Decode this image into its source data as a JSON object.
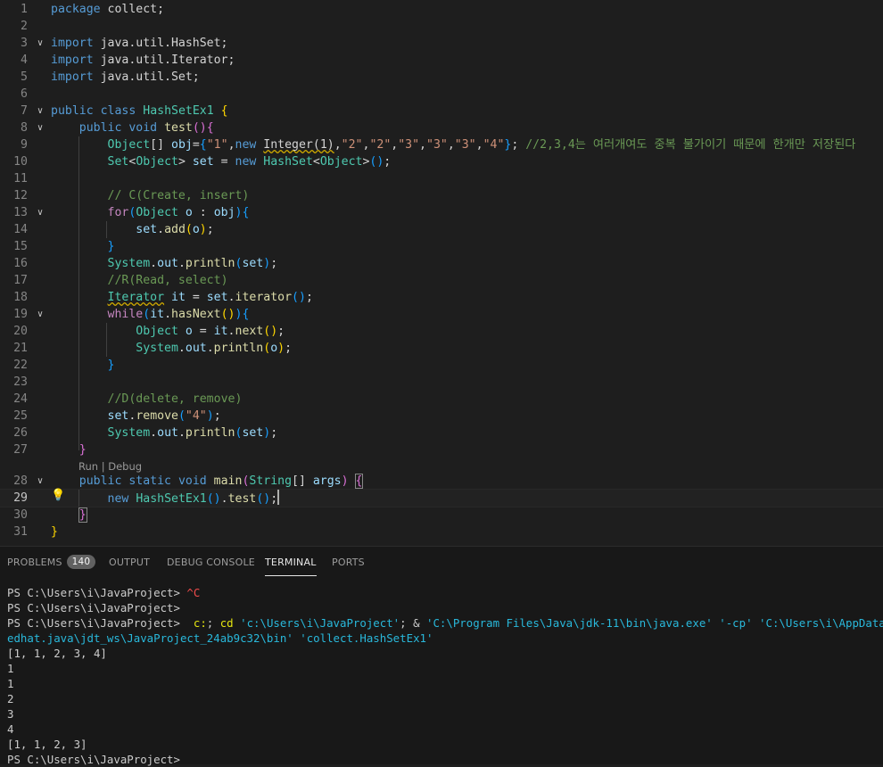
{
  "editor": {
    "lines": [
      {
        "n": "1",
        "tokens": [
          [
            "kw",
            "package"
          ],
          [
            "pl",
            " collect;"
          ]
        ]
      },
      {
        "n": "2",
        "tokens": []
      },
      {
        "n": "3",
        "fold": true,
        "tokens": [
          [
            "kw",
            "import"
          ],
          [
            "pl",
            " java.util.HashSet;"
          ]
        ]
      },
      {
        "n": "4",
        "tokens": [
          [
            "kw",
            "import"
          ],
          [
            "pl",
            " java.util.Iterator;"
          ]
        ]
      },
      {
        "n": "5",
        "tokens": [
          [
            "kw",
            "import"
          ],
          [
            "pl",
            " java.util.Set;"
          ]
        ]
      },
      {
        "n": "6",
        "tokens": []
      },
      {
        "n": "7",
        "fold": true,
        "tokens": [
          [
            "kw",
            "public"
          ],
          [
            "pl",
            " "
          ],
          [
            "kw",
            "class"
          ],
          [
            "pl",
            " "
          ],
          [
            "typ",
            "HashSetEx1"
          ],
          [
            "pl",
            " "
          ],
          [
            "br1",
            "{"
          ]
        ]
      },
      {
        "n": "8",
        "fold": true,
        "tokens": [
          [
            "pl",
            "    "
          ],
          [
            "kw",
            "public"
          ],
          [
            "pl",
            " "
          ],
          [
            "kw",
            "void"
          ],
          [
            "pl",
            " "
          ],
          [
            "fn",
            "test"
          ],
          [
            "br2",
            "()"
          ],
          [
            "br2",
            "{"
          ]
        ]
      },
      {
        "n": "9",
        "tokens": [
          [
            "pl",
            "        "
          ],
          [
            "typ",
            "Object"
          ],
          [
            "pl",
            "[] "
          ],
          [
            "var",
            "obj"
          ],
          [
            "pl",
            "="
          ],
          [
            "br3",
            "{"
          ],
          [
            "str",
            "\"1\""
          ],
          [
            "pl",
            ","
          ],
          [
            "kw",
            "new"
          ],
          [
            "pl",
            " "
          ],
          [
            "depwarn",
            "Integer(1)"
          ],
          [
            "pl",
            ","
          ],
          [
            "str",
            "\"2\""
          ],
          [
            "pl",
            ","
          ],
          [
            "str",
            "\"2\""
          ],
          [
            "pl",
            ","
          ],
          [
            "str",
            "\"3\""
          ],
          [
            "pl",
            ","
          ],
          [
            "str",
            "\"3\""
          ],
          [
            "pl",
            ","
          ],
          [
            "str",
            "\"3\""
          ],
          [
            "pl",
            ","
          ],
          [
            "str",
            "\"4\""
          ],
          [
            "br3",
            "}"
          ],
          [
            "pl",
            "; "
          ],
          [
            "com",
            "//2,3,4는 여러개여도 중복 불가이기 때문에 한개만 저장된다"
          ]
        ]
      },
      {
        "n": "10",
        "tokens": [
          [
            "pl",
            "        "
          ],
          [
            "typ",
            "Set"
          ],
          [
            "pl",
            "<"
          ],
          [
            "typ",
            "Object"
          ],
          [
            "pl",
            "> "
          ],
          [
            "var",
            "set"
          ],
          [
            "pl",
            " = "
          ],
          [
            "kw",
            "new"
          ],
          [
            "pl",
            " "
          ],
          [
            "typ",
            "HashSet"
          ],
          [
            "pl",
            "<"
          ],
          [
            "typ",
            "Object"
          ],
          [
            "pl",
            ">"
          ],
          [
            "br3",
            "()"
          ],
          [
            "pl",
            ";"
          ]
        ]
      },
      {
        "n": "11",
        "tokens": []
      },
      {
        "n": "12",
        "tokens": [
          [
            "pl",
            "        "
          ],
          [
            "com",
            "// C(Create, insert)"
          ]
        ]
      },
      {
        "n": "13",
        "fold": true,
        "tokens": [
          [
            "pl",
            "        "
          ],
          [
            "ctl",
            "for"
          ],
          [
            "br3",
            "("
          ],
          [
            "typ",
            "Object"
          ],
          [
            "pl",
            " "
          ],
          [
            "var",
            "o"
          ],
          [
            "pl",
            " : "
          ],
          [
            "var",
            "obj"
          ],
          [
            "br3",
            ")"
          ],
          [
            "br3",
            "{"
          ]
        ]
      },
      {
        "n": "14",
        "tokens": [
          [
            "pl",
            "            "
          ],
          [
            "var",
            "set"
          ],
          [
            "pl",
            "."
          ],
          [
            "fn",
            "add"
          ],
          [
            "br1",
            "("
          ],
          [
            "var",
            "o"
          ],
          [
            "br1",
            ")"
          ],
          [
            "pl",
            ";"
          ]
        ]
      },
      {
        "n": "15",
        "tokens": [
          [
            "pl",
            "        "
          ],
          [
            "br3",
            "}"
          ]
        ]
      },
      {
        "n": "16",
        "tokens": [
          [
            "pl",
            "        "
          ],
          [
            "typ",
            "System"
          ],
          [
            "pl",
            "."
          ],
          [
            "var",
            "out"
          ],
          [
            "pl",
            "."
          ],
          [
            "fn",
            "println"
          ],
          [
            "br3",
            "("
          ],
          [
            "var",
            "set"
          ],
          [
            "br3",
            ")"
          ],
          [
            "pl",
            ";"
          ]
        ]
      },
      {
        "n": "17",
        "tokens": [
          [
            "pl",
            "        "
          ],
          [
            "com",
            "//R(Read, select)"
          ]
        ]
      },
      {
        "n": "18",
        "tokens": [
          [
            "pl",
            "        "
          ],
          [
            "typwarn",
            "Iterator"
          ],
          [
            "pl",
            " "
          ],
          [
            "var",
            "it"
          ],
          [
            "pl",
            " = "
          ],
          [
            "var",
            "set"
          ],
          [
            "pl",
            "."
          ],
          [
            "fn",
            "iterator"
          ],
          [
            "br3",
            "()"
          ],
          [
            "pl",
            ";"
          ]
        ]
      },
      {
        "n": "19",
        "fold": true,
        "tokens": [
          [
            "pl",
            "        "
          ],
          [
            "ctl",
            "while"
          ],
          [
            "br3",
            "("
          ],
          [
            "var",
            "it"
          ],
          [
            "pl",
            "."
          ],
          [
            "fn",
            "hasNext"
          ],
          [
            "br1",
            "()"
          ],
          [
            "br3",
            ")"
          ],
          [
            "br3",
            "{"
          ]
        ]
      },
      {
        "n": "20",
        "tokens": [
          [
            "pl",
            "            "
          ],
          [
            "typ",
            "Object"
          ],
          [
            "pl",
            " "
          ],
          [
            "var",
            "o"
          ],
          [
            "pl",
            " = "
          ],
          [
            "var",
            "it"
          ],
          [
            "pl",
            "."
          ],
          [
            "fn",
            "next"
          ],
          [
            "br1",
            "()"
          ],
          [
            "pl",
            ";"
          ]
        ]
      },
      {
        "n": "21",
        "tokens": [
          [
            "pl",
            "            "
          ],
          [
            "typ",
            "System"
          ],
          [
            "pl",
            "."
          ],
          [
            "var",
            "out"
          ],
          [
            "pl",
            "."
          ],
          [
            "fn",
            "println"
          ],
          [
            "br1",
            "("
          ],
          [
            "var",
            "o"
          ],
          [
            "br1",
            ")"
          ],
          [
            "pl",
            ";"
          ]
        ]
      },
      {
        "n": "22",
        "tokens": [
          [
            "pl",
            "        "
          ],
          [
            "br3",
            "}"
          ]
        ]
      },
      {
        "n": "23",
        "tokens": []
      },
      {
        "n": "24",
        "tokens": [
          [
            "pl",
            "        "
          ],
          [
            "com",
            "//D(delete, remove)"
          ]
        ]
      },
      {
        "n": "25",
        "tokens": [
          [
            "pl",
            "        "
          ],
          [
            "var",
            "set"
          ],
          [
            "pl",
            "."
          ],
          [
            "fn",
            "remove"
          ],
          [
            "br3",
            "("
          ],
          [
            "str",
            "\"4\""
          ],
          [
            "br3",
            ")"
          ],
          [
            "pl",
            ";"
          ]
        ]
      },
      {
        "n": "26",
        "tokens": [
          [
            "pl",
            "        "
          ],
          [
            "typ",
            "System"
          ],
          [
            "pl",
            "."
          ],
          [
            "var",
            "out"
          ],
          [
            "pl",
            "."
          ],
          [
            "fn",
            "println"
          ],
          [
            "br3",
            "("
          ],
          [
            "var",
            "set"
          ],
          [
            "br3",
            ")"
          ],
          [
            "pl",
            ";"
          ]
        ]
      },
      {
        "n": "27",
        "tokens": [
          [
            "pl",
            "    "
          ],
          [
            "br2",
            "}"
          ]
        ]
      },
      {
        "n": "28",
        "fold": true,
        "tokens": [
          [
            "pl",
            "    "
          ],
          [
            "kw",
            "public"
          ],
          [
            "pl",
            " "
          ],
          [
            "kw",
            "static"
          ],
          [
            "pl",
            " "
          ],
          [
            "kw",
            "void"
          ],
          [
            "pl",
            " "
          ],
          [
            "fn",
            "main"
          ],
          [
            "br2",
            "("
          ],
          [
            "typ",
            "String"
          ],
          [
            "pl",
            "[] "
          ],
          [
            "var",
            "args"
          ],
          [
            "br2",
            ")"
          ],
          [
            "pl",
            " "
          ],
          [
            "brk2",
            "{"
          ]
        ]
      },
      {
        "n": "29",
        "current": true,
        "tokens": [
          [
            "pl",
            "        "
          ],
          [
            "kw",
            "new"
          ],
          [
            "pl",
            " "
          ],
          [
            "typ",
            "HashSetEx1"
          ],
          [
            "br3",
            "()"
          ],
          [
            "pl",
            "."
          ],
          [
            "fn",
            "test"
          ],
          [
            "br3",
            "()"
          ],
          [
            "pl",
            ";"
          ],
          [
            "cursor",
            ""
          ]
        ]
      },
      {
        "n": "30",
        "tokens": [
          [
            "pl",
            "    "
          ],
          [
            "brk2",
            "}"
          ]
        ]
      },
      {
        "n": "31",
        "tokens": [
          [
            "br1",
            "}"
          ]
        ]
      }
    ],
    "codelens": "Run | Debug",
    "lightbulb": "💡"
  },
  "panel": {
    "tabs": [
      {
        "id": "problems",
        "label": "PROBLEMS",
        "badge": "140",
        "active": false
      },
      {
        "id": "output",
        "label": "OUTPUT",
        "active": false
      },
      {
        "id": "debug-console",
        "label": "DEBUG CONSOLE",
        "active": false
      },
      {
        "id": "terminal",
        "label": "TERMINAL",
        "active": true
      },
      {
        "id": "ports",
        "label": "PORTS",
        "active": false
      }
    ],
    "terminal_lines": [
      [
        [
          "pl",
          "PS C:\\Users\\i\\JavaProject> "
        ],
        [
          "red",
          "^C"
        ]
      ],
      [
        [
          "pl",
          "PS C:\\Users\\i\\JavaProject>"
        ]
      ],
      [
        [
          "pl",
          "PS C:\\Users\\i\\JavaProject>  "
        ],
        [
          "yel",
          "c:"
        ],
        [
          "pl",
          "; "
        ],
        [
          "yel",
          "cd"
        ],
        [
          "pl",
          " "
        ],
        [
          "cy",
          "'c:\\Users\\i\\JavaProject'"
        ],
        [
          "pl",
          "; & "
        ],
        [
          "cy",
          "'C:\\Program Files\\Java\\jdk-11\\bin\\java.exe'"
        ],
        [
          "pl",
          " "
        ],
        [
          "cy",
          "'-cp'"
        ],
        [
          "pl",
          " "
        ],
        [
          "cy",
          "'C:\\Users\\i\\AppData\\Roaming"
        ]
      ],
      [
        [
          "cy",
          "edhat.java\\jdt_ws\\JavaProject_24ab9c32\\bin'"
        ],
        [
          "pl",
          " "
        ],
        [
          "cy",
          "'collect.HashSetEx1'"
        ]
      ],
      [
        [
          "pl",
          "[1, 1, 2, 3, 4]"
        ]
      ],
      [
        [
          "pl",
          "1"
        ]
      ],
      [
        [
          "pl",
          "1"
        ]
      ],
      [
        [
          "pl",
          "2"
        ]
      ],
      [
        [
          "pl",
          "3"
        ]
      ],
      [
        [
          "pl",
          "4"
        ]
      ],
      [
        [
          "pl",
          "[1, 1, 2, 3]"
        ]
      ],
      [
        [
          "pl",
          "PS C:\\Users\\i\\JavaProject>"
        ]
      ]
    ]
  }
}
